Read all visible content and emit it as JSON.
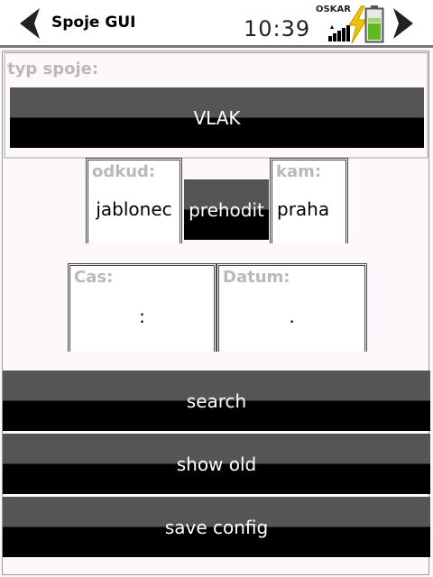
{
  "statusbar": {
    "app_title": "Spoje GUI",
    "clock": "10:39",
    "operator": "OSKAR",
    "icons": [
      "back-arrow-icon",
      "forward-arrow-icon",
      "signal-icon",
      "charging-icon",
      "battery-icon"
    ]
  },
  "form": {
    "typ_label": "typ spoje:",
    "typ_value": "VLAK",
    "odkud_label": "odkud:",
    "odkud_value": "jablonec",
    "swap_label": "prehodit",
    "kam_label": "kam:",
    "kam_value": "praha",
    "cas_label": "Cas:",
    "cas_value": ":",
    "datum_label": "Datum:",
    "datum_value": "."
  },
  "actions": {
    "search": "search",
    "show_old": "show old",
    "save_config": "save config"
  },
  "colors": {
    "button_top": "#555555",
    "button_bottom": "#000000",
    "label_gray": "#b9b9b9",
    "battery_green": "#5fb91f",
    "bolt_yellow": "#f2c200"
  }
}
